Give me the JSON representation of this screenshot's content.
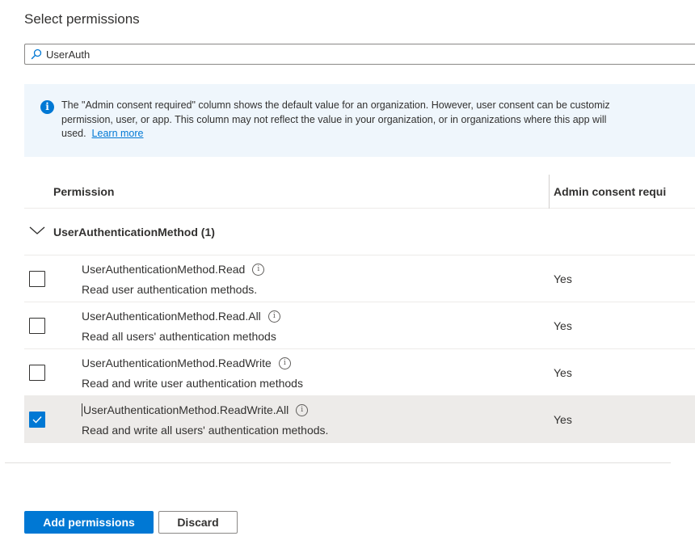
{
  "section_title": "Select permissions",
  "search": {
    "value": "UserAuth",
    "placeholder": ""
  },
  "info_banner": {
    "line1": "The \"Admin consent required\" column shows the default value for an organization. However, user consent can be customiz",
    "line2": "permission, user, or app. This column may not reflect the value in your organization, or in organizations where this app will",
    "line3_prefix": "used.",
    "link_text": "Learn more"
  },
  "table": {
    "headers": {
      "permission": "Permission",
      "admin_consent": "Admin consent requi"
    },
    "group": {
      "label": "UserAuthenticationMethod (1)"
    },
    "rows": [
      {
        "name": "UserAuthenticationMethod.Read",
        "description": "Read user authentication methods.",
        "admin_consent": "Yes",
        "checked": false
      },
      {
        "name": "UserAuthenticationMethod.Read.All",
        "description": "Read all users' authentication methods",
        "admin_consent": "Yes",
        "checked": false
      },
      {
        "name": "UserAuthenticationMethod.ReadWrite",
        "description": "Read and write user authentication methods",
        "admin_consent": "Yes",
        "checked": false
      },
      {
        "name": "UserAuthenticationMethod.ReadWrite.All",
        "description": "Read and write all users' authentication methods.",
        "admin_consent": "Yes",
        "checked": true
      }
    ]
  },
  "buttons": {
    "add_permissions": "Add permissions",
    "discard": "Discard"
  },
  "colors": {
    "accent": "#0078d4",
    "banner_bg": "#eff6fc",
    "selected_row_bg": "#edebe9"
  },
  "icons": {
    "search": "search-icon",
    "info": "info-icon",
    "chevron": "chevron-down-icon",
    "check": "checkmark-icon"
  }
}
